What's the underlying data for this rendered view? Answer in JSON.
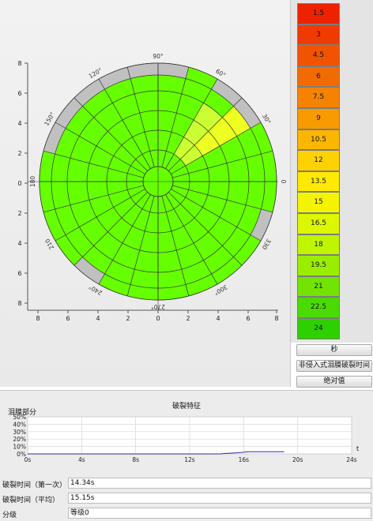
{
  "polar_plot": {
    "x_ticks": [
      "8",
      "6",
      "4",
      "2",
      "0",
      "2",
      "4",
      "6",
      "8"
    ],
    "y_ticks": [
      "8",
      "6",
      "4",
      "2",
      "0",
      "2",
      "4",
      "6",
      "8"
    ],
    "angle_labels": [
      "0",
      "30°",
      "60°",
      "90°",
      "120°",
      "150°",
      "180",
      "210",
      "240°",
      "270°",
      "300°",
      "330"
    ],
    "colors": {
      "green": "#66ff00",
      "yellow_green": "#ccff33",
      "yellow": "#eeff22",
      "gray": "#c0c0c0"
    }
  },
  "color_scale": {
    "values": [
      "1.5",
      "3",
      "4.5",
      "6",
      "7.5",
      "9",
      "10.5",
      "12",
      "13.5",
      "15",
      "16.5",
      "18",
      "19.5",
      "21",
      "22.5",
      "24"
    ],
    "colors": [
      "#ee2200",
      "#ef3a00",
      "#f05400",
      "#f26b00",
      "#f58300",
      "#f89b00",
      "#fbb600",
      "#fdd200",
      "#feea00",
      "#f4f300",
      "#dcf700",
      "#c0f500",
      "#9bed00",
      "#72e400",
      "#4bdb00",
      "#2ed000"
    ]
  },
  "buttons": {
    "seconds": "秒",
    "non_invasive_tbut": "非侵入式泪膜破裂时间",
    "absolute_value": "绝对值"
  },
  "rupture_chart": {
    "title": "破裂特征",
    "ylabel": "泪膜部分",
    "y_ticks": [
      "50%",
      "40%",
      "30%",
      "20%",
      "10%",
      "0%"
    ],
    "x_ticks": [
      "0s",
      "4s",
      "8s",
      "12s",
      "16s",
      "20s",
      "24s"
    ],
    "x_axis_letter": "t"
  },
  "chart_data": {
    "type": "line",
    "title": "破裂特征",
    "xlabel": "t",
    "ylabel": "泪膜部分",
    "xlim": [
      0,
      24
    ],
    "ylim": [
      0,
      50
    ],
    "series": [
      {
        "x": [
          0,
          14.34,
          14.6,
          15.0,
          15.5,
          16.0,
          16.3,
          17.0,
          18.0,
          19.0
        ],
        "y": [
          0,
          0,
          0.6,
          1.0,
          1.5,
          2.2,
          3.0,
          3.0,
          3.0,
          3.0
        ]
      }
    ]
  },
  "fields": {
    "first_label": "破裂时间（第一次）",
    "first_value": "14.34s",
    "avg_label": "破裂时间（平均）",
    "avg_value": "15.15s",
    "grade_label": "分级",
    "grade_value": "等级0"
  }
}
